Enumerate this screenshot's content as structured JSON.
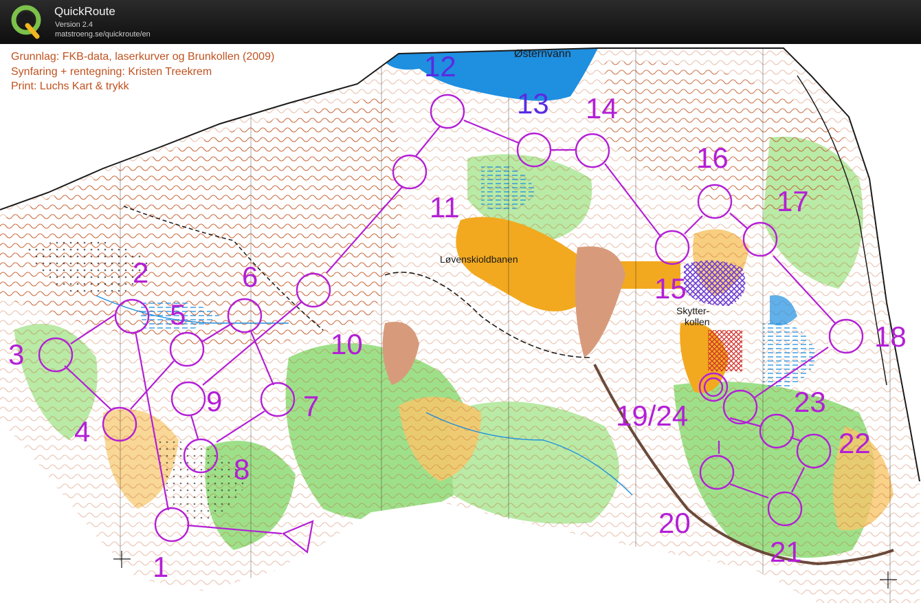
{
  "app": {
    "title": "QuickRoute",
    "version": "Version 2.4",
    "url": "matstroeng.se/quickroute/en"
  },
  "map": {
    "credits": [
      "Grunnlag: FKB-data, laserkurver og Brunkollen (2009)",
      "Synfaring + rentegning: Kristen Treekrem",
      "Print: Luchs Kart & trykk"
    ],
    "lake_name": "Østernvann",
    "places": {
      "stadium": "Løvenskioldbanen",
      "hill_line1": "Skytter-",
      "hill_line2": "kollen"
    },
    "controls": [
      "1",
      "2",
      "3",
      "4",
      "5",
      "6",
      "7",
      "8",
      "9",
      "10",
      "11",
      "12",
      "13",
      "14",
      "15",
      "16",
      "17",
      "18",
      "19/24",
      "20",
      "21",
      "22",
      "23"
    ],
    "colors": {
      "course_purple": "#b31fd6",
      "water_blue": "#1f8fe0",
      "contour_brown": "#c0521f",
      "vegetation_green": "#9ee08a",
      "open_yellow": "#f7c66a",
      "building_orange": "#f2a91f"
    }
  }
}
